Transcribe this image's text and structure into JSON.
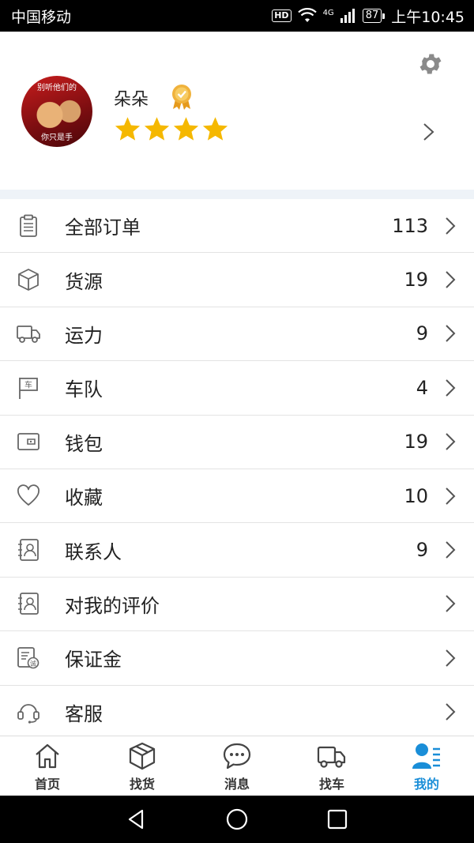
{
  "status_bar": {
    "carrier": "中国移动",
    "hd": "HD",
    "network": "4G",
    "battery": "87",
    "time": "上午10:45"
  },
  "profile": {
    "username": "朵朵",
    "avatar_caption_top": "别听他们的",
    "avatar_caption_bottom": "你只是手",
    "rating_stars": 4,
    "medal_icon": "medal-icon",
    "settings_icon": "gear-icon"
  },
  "menu": {
    "items": [
      {
        "label": "全部订单",
        "count": "113",
        "icon": "clipboard-icon"
      },
      {
        "label": "货源",
        "count": "19",
        "icon": "package-icon"
      },
      {
        "label": "运力",
        "count": "9",
        "icon": "truck-icon"
      },
      {
        "label": "车队",
        "count": "4",
        "icon": "flag-icon"
      },
      {
        "label": "钱包",
        "count": "19",
        "icon": "wallet-icon"
      },
      {
        "label": "收藏",
        "count": "10",
        "icon": "heart-icon"
      },
      {
        "label": "联系人",
        "count": "9",
        "icon": "contact-card-icon"
      },
      {
        "label": "对我的评价",
        "count": "",
        "icon": "review-card-icon"
      },
      {
        "label": "保证金",
        "count": "",
        "icon": "deposit-icon"
      },
      {
        "label": "客服",
        "count": "",
        "icon": "headset-icon"
      }
    ]
  },
  "tabs": [
    {
      "label": "首页",
      "icon": "home-icon",
      "active": false
    },
    {
      "label": "找货",
      "icon": "package-icon",
      "active": false
    },
    {
      "label": "消息",
      "icon": "chat-bubble-icon",
      "active": false
    },
    {
      "label": "找车",
      "icon": "truck-icon",
      "active": false
    },
    {
      "label": "我的",
      "icon": "user-list-icon",
      "active": true
    }
  ],
  "colors": {
    "accent": "#1a8ed8",
    "star": "#f5b800",
    "medal": "#f0b23c",
    "section_band": "#eef3f8"
  }
}
